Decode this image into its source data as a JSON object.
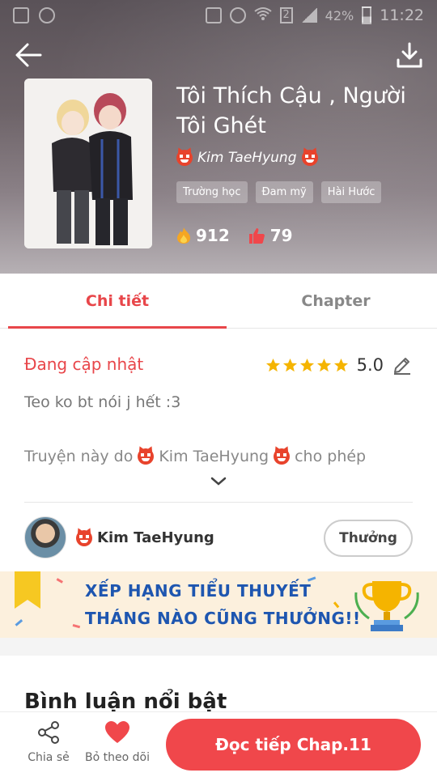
{
  "status_bar": {
    "battery": "42%",
    "sim": "2",
    "time": "11:22"
  },
  "book": {
    "title": "Tôi Thích Cậu , Người Tôi Ghét",
    "author": "Kim TaeHyung",
    "tags": [
      "Trường học",
      "Đam mỹ",
      "Hài Hước"
    ],
    "views": "912",
    "likes": "79"
  },
  "tabs": [
    {
      "label": "Chi tiết",
      "active": true
    },
    {
      "label": "Chapter",
      "active": false
    }
  ],
  "detail": {
    "status": "Đang cập nhật",
    "rating": "5.0",
    "stars": 5,
    "description": "Teo ko bt nói j hết :3",
    "permission_prefix": "Truyện này do",
    "permission_author": "Kim TaeHyung",
    "permission_suffix": "cho phép"
  },
  "author_block": {
    "name": "Kim TaeHyung",
    "reward_label": "Thưởng"
  },
  "banner": {
    "line1": "XẾP HẠNG TIỂU THUYẾT",
    "line2": "THÁNG NÀO CŨNG THƯỞNG!!"
  },
  "section": {
    "title": "Bình luận nổi bật"
  },
  "bottom_bar": {
    "share_label": "Chia sẻ",
    "follow_label": "Bỏ theo dõi",
    "read_label": "Đọc tiếp Chap.11"
  },
  "colors": {
    "accent": "#e8464a",
    "banner_text": "#1e56b0"
  }
}
